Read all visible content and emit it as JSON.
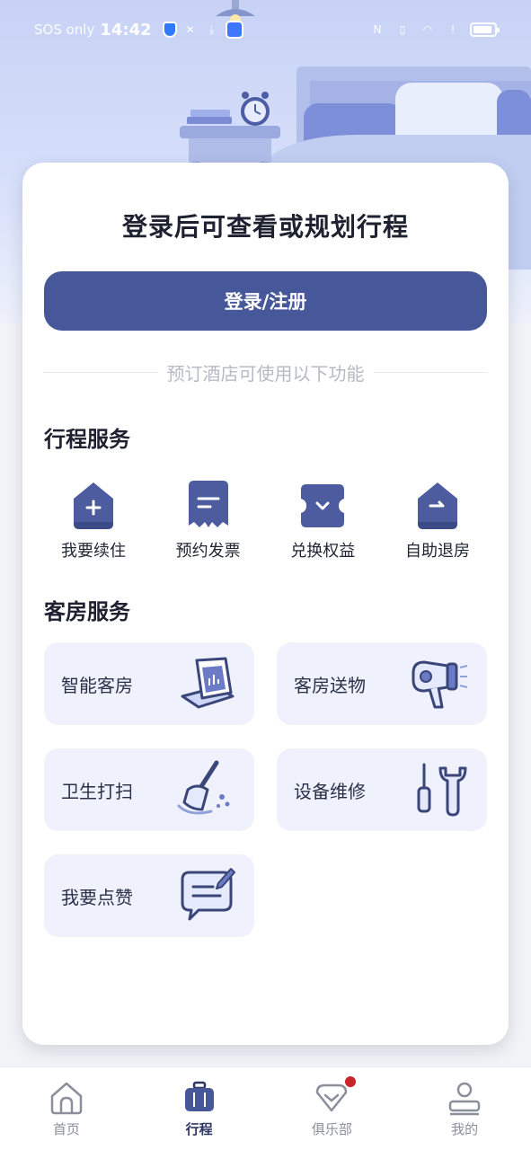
{
  "status_bar": {
    "carrier": "SOS only",
    "time": "14:42"
  },
  "card": {
    "title": "登录后可查看或规划行程",
    "login_button": "登录/注册",
    "divider_text": "预订酒店可使用以下功能"
  },
  "trip_services": {
    "title": "行程服务",
    "items": [
      {
        "label": "我要续住",
        "icon": "plus-house-icon"
      },
      {
        "label": "预约发票",
        "icon": "receipt-icon"
      },
      {
        "label": "兑换权益",
        "icon": "ticket-icon"
      },
      {
        "label": "自助退房",
        "icon": "checkout-house-icon"
      }
    ]
  },
  "room_services": {
    "title": "客房服务",
    "items": [
      {
        "label": "智能客房",
        "icon": "tablet-icon"
      },
      {
        "label": "客房送物",
        "icon": "hair-dryer-icon"
      },
      {
        "label": "卫生打扫",
        "icon": "broom-icon"
      },
      {
        "label": "设备维修",
        "icon": "wrench-icon"
      },
      {
        "label": "我要点赞",
        "icon": "chat-bubble-icon"
      }
    ]
  },
  "bottom_nav": {
    "items": [
      {
        "label": "首页",
        "icon": "home-icon",
        "active": false
      },
      {
        "label": "行程",
        "icon": "suitcase-icon",
        "active": true
      },
      {
        "label": "俱乐部",
        "icon": "club-icon",
        "active": false,
        "badge": true
      },
      {
        "label": "我的",
        "icon": "profile-icon",
        "active": false
      }
    ]
  },
  "colors": {
    "primary": "#46579a",
    "tile_bg": "#eff2fc",
    "icon": "#4d5c9e",
    "badge": "#c8242a"
  }
}
